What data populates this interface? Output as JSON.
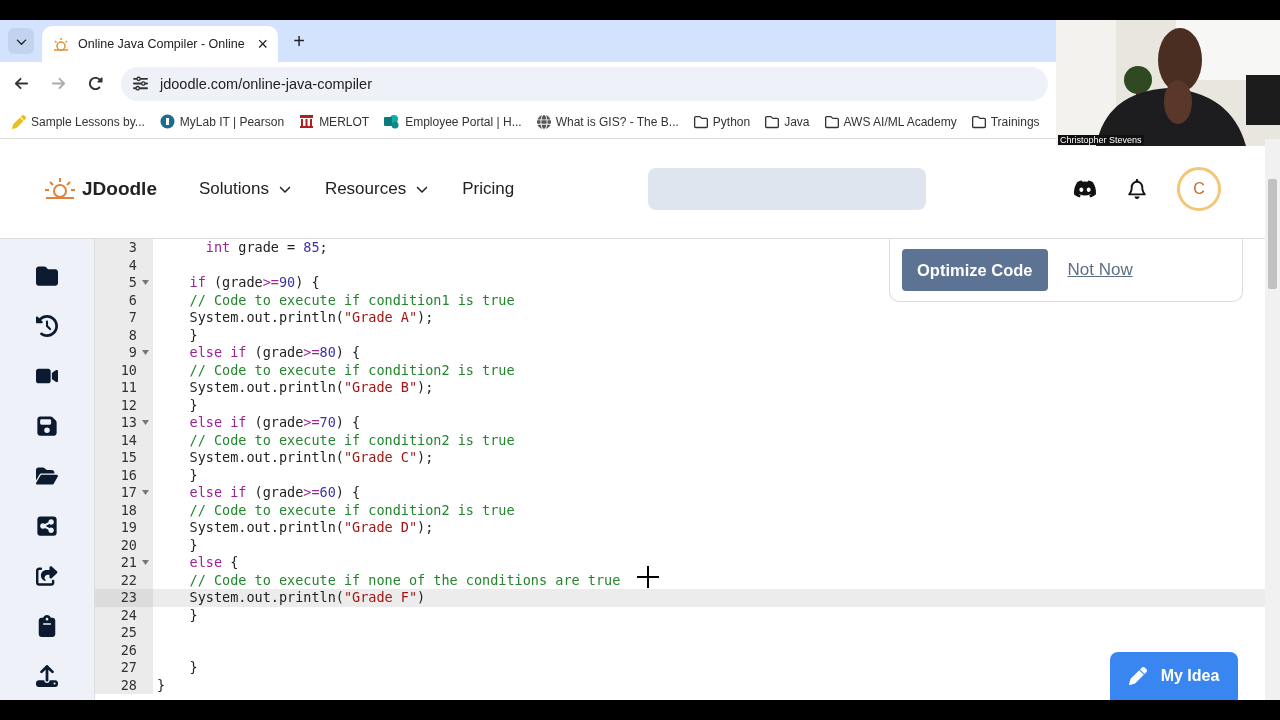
{
  "browser": {
    "tab": {
      "title": "Online Java Compiler - Online",
      "close": "×"
    },
    "new_tab": "+",
    "url": "jdoodle.com/online-java-compiler",
    "bookmarks": [
      {
        "kind": "pencil",
        "label": "Sample Lessons by..."
      },
      {
        "kind": "badge",
        "label": "MyLab IT | Pearson"
      },
      {
        "kind": "columns",
        "label": "MERLOT"
      },
      {
        "kind": "portal",
        "label": "Employee Portal | H..."
      },
      {
        "kind": "globe",
        "label": "What is GIS? - The B..."
      },
      {
        "kind": "folder",
        "label": "Python"
      },
      {
        "kind": "folder",
        "label": "Java"
      },
      {
        "kind": "folder",
        "label": "AWS AI/ML Academy"
      },
      {
        "kind": "folder",
        "label": "Trainings"
      }
    ]
  },
  "webcam": {
    "kind": "picture",
    "caption": "Christopher Stevens"
  },
  "header": {
    "brand": "JDoodle",
    "nav": [
      {
        "label": "Solutions",
        "dropdown": true
      },
      {
        "label": "Resources",
        "dropdown": true
      },
      {
        "label": "Pricing",
        "dropdown": false
      }
    ],
    "avatar": "C"
  },
  "editor": {
    "lines": [
      {
        "number": "3",
        "fold": false,
        "active": false,
        "tokens": [
          {
            "kind": "kw",
            "text": "      int"
          },
          {
            "kind": "plain",
            "text": " grade = "
          },
          {
            "kind": "num",
            "text": "85"
          },
          {
            "kind": "plain",
            "text": ";"
          }
        ]
      },
      {
        "number": "4",
        "fold": false,
        "active": false
      },
      {
        "number": "5",
        "fold": true,
        "active": false,
        "tokens": [
          {
            "kind": "kw",
            "text": "    if"
          },
          {
            "kind": "plain",
            "text": " (grade"
          },
          {
            "kind": "op",
            "text": ">="
          },
          {
            "kind": "num",
            "text": "90"
          },
          {
            "kind": "plain",
            "text": ") {"
          }
        ]
      },
      {
        "number": "6",
        "fold": false,
        "active": false,
        "tokens": [
          {
            "kind": "comment",
            "text": "    // Code to execute if condition1 is true"
          }
        ]
      },
      {
        "number": "7",
        "fold": false,
        "active": false,
        "tokens": [
          {
            "kind": "plain",
            "text": "    System.out.println("
          },
          {
            "kind": "str",
            "text": "\"Grade A\""
          },
          {
            "kind": "plain",
            "text": ");"
          }
        ]
      },
      {
        "number": "8",
        "fold": false,
        "active": false,
        "tokens": [
          {
            "kind": "plain",
            "text": "    }"
          }
        ]
      },
      {
        "number": "9",
        "fold": true,
        "active": false,
        "tokens": [
          {
            "kind": "kw",
            "text": "    else if"
          },
          {
            "kind": "plain",
            "text": " (grade"
          },
          {
            "kind": "op",
            "text": ">="
          },
          {
            "kind": "num",
            "text": "80"
          },
          {
            "kind": "plain",
            "text": ") {"
          }
        ]
      },
      {
        "number": "10",
        "fold": false,
        "active": false,
        "tokens": [
          {
            "kind": "comment",
            "text": "    // Code to execute if condition2 is true"
          }
        ]
      },
      {
        "number": "11",
        "fold": false,
        "active": false,
        "tokens": [
          {
            "kind": "plain",
            "text": "    System.out.println("
          },
          {
            "kind": "str",
            "text": "\"Grade B\""
          },
          {
            "kind": "plain",
            "text": ");"
          }
        ]
      },
      {
        "number": "12",
        "fold": false,
        "active": false,
        "tokens": [
          {
            "kind": "plain",
            "text": "    }"
          }
        ]
      },
      {
        "number": "13",
        "fold": true,
        "active": false,
        "tokens": [
          {
            "kind": "kw",
            "text": "    else if"
          },
          {
            "kind": "plain",
            "text": " (grade"
          },
          {
            "kind": "op",
            "text": ">="
          },
          {
            "kind": "num",
            "text": "70"
          },
          {
            "kind": "plain",
            "text": ") {"
          }
        ]
      },
      {
        "number": "14",
        "fold": false,
        "active": false,
        "tokens": [
          {
            "kind": "comment",
            "text": "    // Code to execute if condition2 is true"
          }
        ]
      },
      {
        "number": "15",
        "fold": false,
        "active": false,
        "tokens": [
          {
            "kind": "plain",
            "text": "    System.out.println("
          },
          {
            "kind": "str",
            "text": "\"Grade C\""
          },
          {
            "kind": "plain",
            "text": ");"
          }
        ]
      },
      {
        "number": "16",
        "fold": false,
        "active": false,
        "tokens": [
          {
            "kind": "plain",
            "text": "    }"
          }
        ]
      },
      {
        "number": "17",
        "fold": true,
        "active": false,
        "tokens": [
          {
            "kind": "kw",
            "text": "    else if"
          },
          {
            "kind": "plain",
            "text": " (grade"
          },
          {
            "kind": "op",
            "text": ">="
          },
          {
            "kind": "num",
            "text": "60"
          },
          {
            "kind": "plain",
            "text": ") {"
          }
        ]
      },
      {
        "number": "18",
        "fold": false,
        "active": false,
        "tokens": [
          {
            "kind": "comment",
            "text": "    // Code to execute if condition2 is true"
          }
        ]
      },
      {
        "number": "19",
        "fold": false,
        "active": false,
        "tokens": [
          {
            "kind": "plain",
            "text": "    System.out.println("
          },
          {
            "kind": "str",
            "text": "\"Grade D\""
          },
          {
            "kind": "plain",
            "text": ");"
          }
        ]
      },
      {
        "number": "20",
        "fold": false,
        "active": false,
        "tokens": [
          {
            "kind": "plain",
            "text": "    }"
          }
        ]
      },
      {
        "number": "21",
        "fold": true,
        "active": false,
        "tokens": [
          {
            "kind": "kw",
            "text": "    else"
          },
          {
            "kind": "plain",
            "text": " {"
          }
        ]
      },
      {
        "number": "22",
        "fold": false,
        "active": false,
        "tokens": [
          {
            "kind": "comment",
            "text": "    // Code to execute if none of the conditions are true"
          }
        ]
      },
      {
        "number": "23",
        "fold": false,
        "active": true,
        "tokens": [
          {
            "kind": "plain",
            "text": "    System.out.println("
          },
          {
            "kind": "str",
            "text": "\"Grade F\""
          },
          {
            "kind": "plain",
            "text": ")"
          }
        ]
      },
      {
        "number": "24",
        "fold": false,
        "active": false,
        "tokens": [
          {
            "kind": "plain",
            "text": "    }"
          }
        ]
      },
      {
        "number": "25",
        "fold": false,
        "active": false
      },
      {
        "number": "26",
        "fold": false,
        "active": false
      },
      {
        "number": "27",
        "fold": false,
        "active": false,
        "tokens": [
          {
            "kind": "plain",
            "text": "    }"
          }
        ]
      },
      {
        "number": "28",
        "fold": false,
        "active": false,
        "tokens": [
          {
            "kind": "plain",
            "text": "}"
          }
        ]
      }
    ]
  },
  "optimize_prompt": {
    "primary": "Optimize Code",
    "secondary": "Not Now"
  },
  "idea_button": "My Idea"
}
